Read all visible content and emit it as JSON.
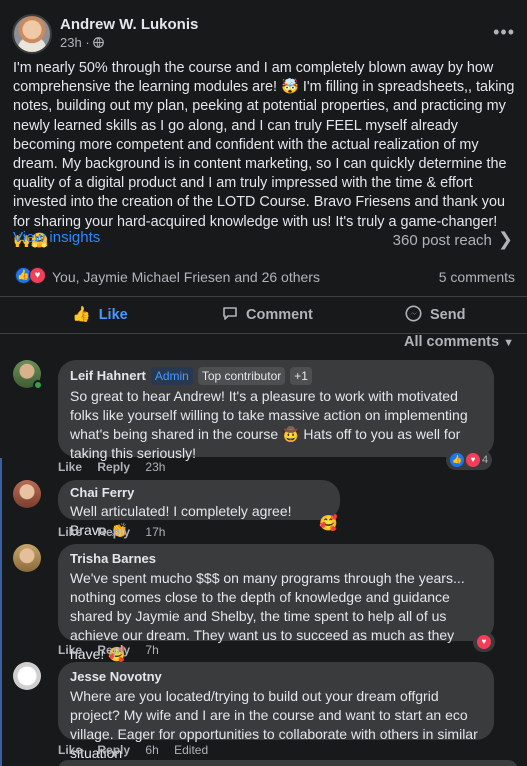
{
  "post": {
    "author": "Andrew W. Lukonis",
    "time": "23h",
    "privacy_icon": "globe-icon",
    "body": "I'm nearly 50% through the course and I am completely blown away by how comprehensive the learning modules are! 🤯 I'm filling in spreadsheets,, taking notes, building out my plan, peeking at potential properties, and practicing my newly learned skills as I go along, and I can truly FEEL myself already becoming more competent and confident with the actual realization of my dream.  My background is in content marketing, so I can quickly determine the quality of a digital product and I am truly impressed with the time & effort invested into the creation of the LOTD Course. Bravo Friesens and thank you for sharing your hard-acquired knowledge with us! It's truly a game-changer! 🙌🤗"
  },
  "insights": {
    "label": "View insights",
    "reach": "360 post reach"
  },
  "reactions": {
    "summary": "You, Jaymie Michael Friesen and 26 others",
    "comments": "5 comments"
  },
  "actions": {
    "like": "Like",
    "comment": "Comment",
    "send": "Send"
  },
  "all_comments": "All comments",
  "comments": [
    {
      "name": "Leif Hahnert",
      "badge_admin": "Admin",
      "badge_top": "Top contributor",
      "badge_plus": "+1",
      "text": "So great to hear Andrew! It's a pleasure to work with motivated folks like yourself willing to take massive action on implementing what's being shared in the course 🤠 Hats off to you as well for taking this seriously!",
      "like": "Like",
      "reply": "Reply",
      "time": "23h",
      "reaction_count": "4"
    },
    {
      "name": "Chai Ferry",
      "text": "Well articulated! I completely agree! Bravo 👏",
      "like": "Like",
      "reply": "Reply",
      "time": "17h",
      "reaction_emoji": "🥰"
    },
    {
      "name": "Trisha Barnes",
      "text": "We've spent mucho $$$ on many programs through the years... nothing comes close to the depth of knowledge and guidance shared by Jaymie and Shelby, the time spent to help all of us achieve our dream. They want us to succeed as much as they have! 🥰",
      "like": "Like",
      "reply": "Reply",
      "time": "7h"
    },
    {
      "name": "Jesse Novotny",
      "text": "Where are you located/trying to build out your dream offgrid project? My wife and I are in the course and want to start an eco village. Eager for opportunities to collaborate with others in similar situation",
      "like": "Like",
      "reply": "Reply",
      "time": "6h",
      "edited": "Edited"
    }
  ],
  "colors": {
    "accent": "#2d88ff",
    "like_blue": "#1877f2",
    "love_red": "#f33e58",
    "bubble": "#3a3b3c"
  }
}
